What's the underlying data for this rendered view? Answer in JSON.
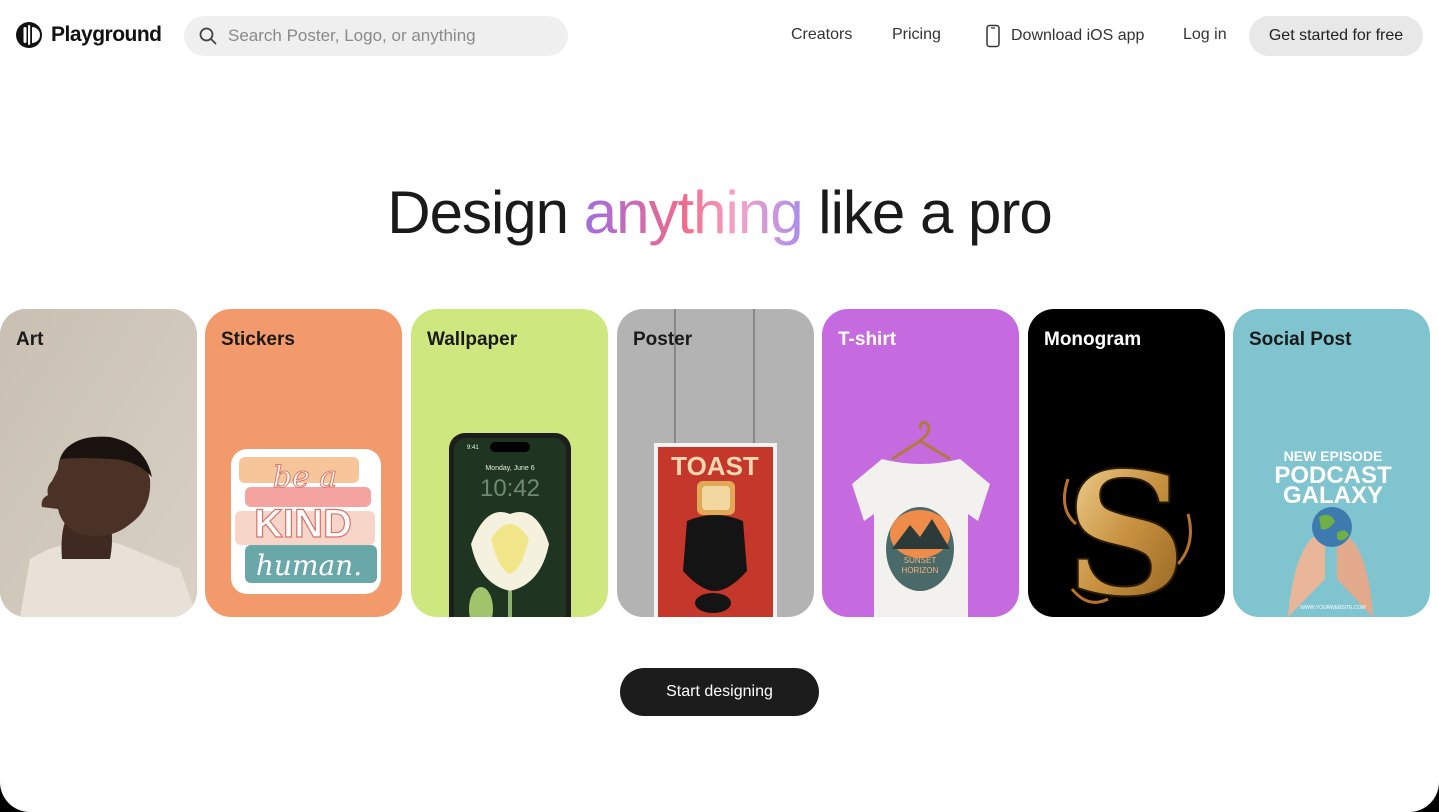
{
  "brand": {
    "name": "Playground"
  },
  "search": {
    "placeholder": "Search Poster, Logo, or anything"
  },
  "nav": {
    "creators": "Creators",
    "pricing": "Pricing",
    "ios": "Download iOS app",
    "login": "Log in",
    "get_started": "Get started for free"
  },
  "hero": {
    "before": "Design",
    "highlight": "anything",
    "after": "like a pro"
  },
  "cards": [
    {
      "label": "Art",
      "bg": "#cfc6bb",
      "text_color": "#1a1a1a"
    },
    {
      "label": "Stickers",
      "bg": "#f29a6b",
      "text_color": "#1a1a1a"
    },
    {
      "label": "Wallpaper",
      "bg": "#cfe77f",
      "text_color": "#1a1a1a"
    },
    {
      "label": "Poster",
      "bg": "#b3b3b3",
      "text_color": "#1a1a1a"
    },
    {
      "label": "T-shirt",
      "bg": "#c66ae0",
      "text_color": "#ffffff"
    },
    {
      "label": "Monogram",
      "bg": "#000000",
      "text_color": "#ffffff"
    },
    {
      "label": "Social Post",
      "bg": "#80c4cf",
      "text_color": "#1a1a1a"
    }
  ],
  "card_art": {
    "sticker_lines": [
      "be a",
      "KIND",
      "human."
    ],
    "wallpaper_date": "Monday, June 6",
    "wallpaper_time": "10:42",
    "wallpaper_status": "9:41",
    "poster_title": "TOAST",
    "tshirt_lines": [
      "SUNSET",
      "HORIZON"
    ],
    "monogram_letter": "S",
    "social_lines": [
      "NEW EPISODE",
      "PODCAST",
      "GALAXY"
    ],
    "social_url": "WWW.YOURWEBSITE.COM"
  },
  "bottom": {
    "start": "Start designing"
  },
  "icons": {
    "logo": "playground-logo-icon",
    "search": "search-icon",
    "phone": "phone-icon"
  },
  "colors": {
    "cta_dark": "#1c1c1c",
    "chip_bg": "#efefef"
  }
}
